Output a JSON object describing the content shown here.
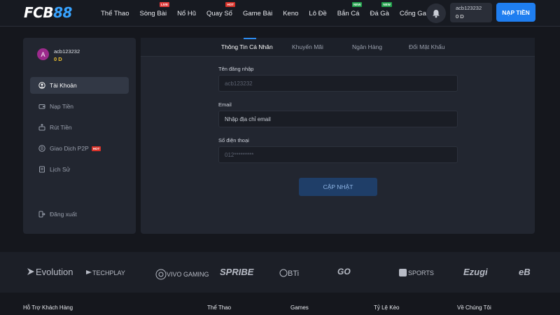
{
  "header": {
    "logo_main": "FCB",
    "logo_accent": "88",
    "nav": [
      {
        "label": "Thể Thao",
        "badge": ""
      },
      {
        "label": "Sòng Bài",
        "badge": "LIVE"
      },
      {
        "label": "Nổ Hũ",
        "badge": ""
      },
      {
        "label": "Quay Số",
        "badge": "HOT"
      },
      {
        "label": "Game Bài",
        "badge": ""
      },
      {
        "label": "Keno",
        "badge": ""
      },
      {
        "label": "Lô Đề",
        "badge": ""
      },
      {
        "label": "Bắn Cá",
        "badge": "NEW"
      },
      {
        "label": "Đá Gà",
        "badge": "NEW"
      },
      {
        "label": "Cổng Game",
        "badge": ""
      }
    ],
    "username": "acb123232",
    "balance": "0 D",
    "deposit_label": "NẠP TIỀN"
  },
  "sidebar": {
    "avatar_letter": "A",
    "username": "acb123232",
    "balance": "0 D",
    "items": [
      {
        "label": "Tài Khoản",
        "icon": "user-circle-icon",
        "active": true
      },
      {
        "label": "Nạp Tiền",
        "icon": "wallet-icon",
        "active": false
      },
      {
        "label": "Rút Tiền",
        "icon": "withdraw-icon",
        "active": false
      },
      {
        "label": "Giao Dịch P2P",
        "icon": "coin-icon",
        "active": false,
        "tag": "HOT"
      },
      {
        "label": "Lịch Sử",
        "icon": "history-icon",
        "active": false
      }
    ],
    "logout_label": "Đăng xuất"
  },
  "tabs": [
    "Thông Tin Cá Nhân",
    "Khuyến Mãi",
    "Ngân Hàng",
    "Đổi Mật Khẩu"
  ],
  "form": {
    "username_label": "Tên đăng nhập",
    "username_value": "acb123232",
    "email_label": "Email",
    "email_placeholder": "Nhập địa chỉ email",
    "phone_label": "Số điện thoại",
    "phone_value": "012*********",
    "update_label": "CẬP NHẬT"
  },
  "partners": [
    "Evolution",
    "TECHPLAY",
    "VIVO GAMING",
    "SPRIBE",
    "BTi",
    "GO",
    "SPORTS",
    "Ezugi",
    "eB"
  ],
  "footer": [
    "Hỗ Trợ Khách Hàng",
    "Thể Thao",
    "Games",
    "Tỷ Lệ Kèo",
    "Về Chúng Tôi"
  ],
  "colors": {
    "accent": "#1f7ef0",
    "balance": "#f0c330",
    "avatar": "#9c2a8c"
  }
}
